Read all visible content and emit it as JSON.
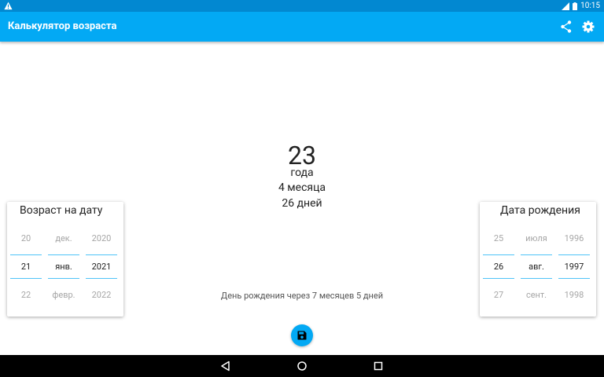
{
  "status_bar": {
    "time": "10:15",
    "icons": [
      "warning-icon",
      "signal-icon",
      "battery-icon"
    ]
  },
  "app_bar": {
    "title": "Калькулятор возраста",
    "actions": [
      "share-icon",
      "settings-icon"
    ]
  },
  "age": {
    "years": "23",
    "years_unit": "года",
    "months": "4 месяца",
    "days": "26 дней"
  },
  "next_birthday": "День рождения через 7 месяцев 5 дней",
  "target_date_card": {
    "title": "Возраст на дату",
    "day": {
      "prev": "20",
      "current": "21",
      "next": "22"
    },
    "month": {
      "prev": "дек.",
      "current": "янв.",
      "next": "февр."
    },
    "year": {
      "prev": "2020",
      "current": "2021",
      "next": "2022"
    }
  },
  "birth_date_card": {
    "title": "Дата рождения",
    "day": {
      "prev": "25",
      "current": "26",
      "next": "27"
    },
    "month": {
      "prev": "июля",
      "current": "авг.",
      "next": "сент."
    },
    "year": {
      "prev": "1996",
      "current": "1997",
      "next": "1998"
    }
  },
  "fab_icon": "save-icon",
  "nav_bar": [
    "back-icon",
    "home-icon",
    "recents-icon"
  ],
  "colors": {
    "primary": "#03a9f4",
    "primary_dark": "#0288d1",
    "picker_line": "#4fc3f7"
  }
}
